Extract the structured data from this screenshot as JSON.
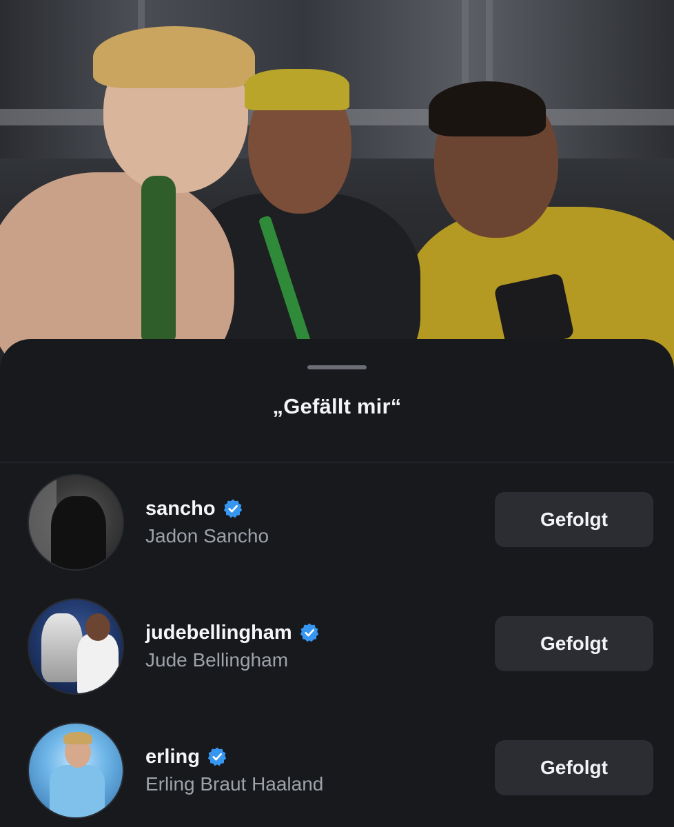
{
  "sheet": {
    "title": "„Gefällt mir“"
  },
  "likes": [
    {
      "username": "sancho",
      "full_name": "Jadon Sancho",
      "verified": true,
      "button_label": "Gefolgt"
    },
    {
      "username": "judebellingham",
      "full_name": "Jude Bellingham",
      "verified": true,
      "button_label": "Gefolgt"
    },
    {
      "username": "erling",
      "full_name": "Erling Braut Haaland",
      "verified": true,
      "button_label": "Gefolgt"
    }
  ],
  "colors": {
    "sheet_background": "#17191d",
    "verified_badge": "#3797f0",
    "button_background": "#2b2d33",
    "primary_text": "#f5f6f7",
    "secondary_text": "#9ea2a9"
  },
  "icons": {
    "verified": "verified-badge-icon"
  }
}
